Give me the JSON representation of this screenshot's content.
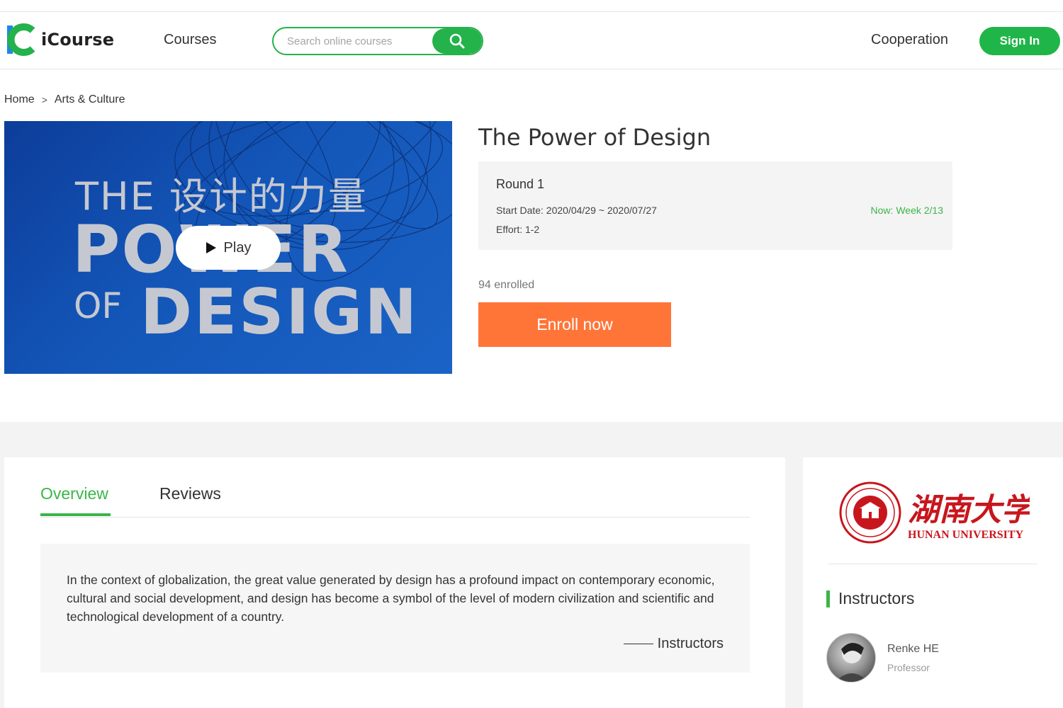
{
  "header": {
    "brand": "iCourse",
    "nav_courses": "Courses",
    "search_placeholder": "Search online courses",
    "cooperation": "Cooperation",
    "sign_in": "Sign In",
    "accent_color": "#24b24b"
  },
  "breadcrumb": {
    "home": "Home",
    "separator": ">",
    "category": "Arts & Culture"
  },
  "video": {
    "line1": "THE 设计的力量",
    "line2": "POWER",
    "line3_of": "OF",
    "line3_design": "DESIGN",
    "play_label": "Play"
  },
  "course": {
    "title": "The Power of Design",
    "round": "Round 1",
    "start_date": "Start Date: 2020/04/29 ~ 2020/07/27",
    "effort": "Effort: 1-2",
    "now_week": "Now: Week 2/13",
    "enrolled": "94 enrolled",
    "enroll_button": "Enroll now",
    "enroll_color": "#ff7538"
  },
  "tabs": [
    {
      "label": "Overview",
      "active": true
    },
    {
      "label": "Reviews",
      "active": false
    }
  ],
  "overview": {
    "text": "In the context of globalization, the great value generated by design has a profound impact on contemporary economic, cultural and social development, and design has become a symbol of the level of modern civilization and scientific and technological development of a country.",
    "signature": "Instructors"
  },
  "sidebar": {
    "university_cn": "湖南大学",
    "university_en": "HUNAN UNIVERSITY",
    "instructors_title": "Instructors",
    "instructors": [
      {
        "name": "Renke HE",
        "role": "Professor"
      }
    ]
  }
}
